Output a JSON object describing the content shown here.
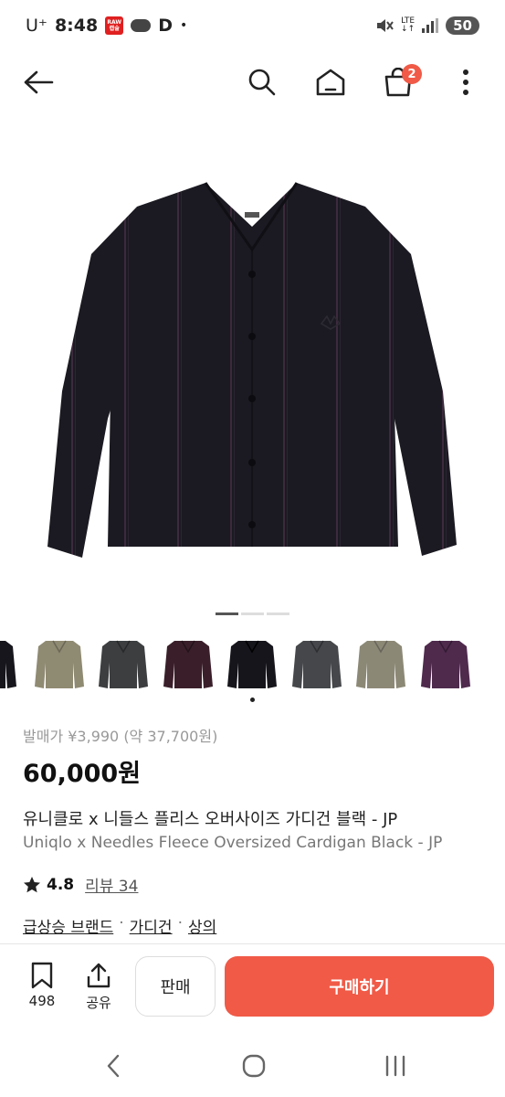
{
  "status_bar": {
    "carrier": "U⁺",
    "time": "8:48",
    "app_badge": "RAW 캡슐",
    "d_label": "D",
    "dot": "•",
    "lte": "LTE",
    "battery": "50"
  },
  "header": {
    "cart_count": "2"
  },
  "carousel": {
    "total": 3,
    "active": 1
  },
  "thumbnails": [
    {
      "name": "thumb-black-partial",
      "color": "#16161c"
    },
    {
      "name": "thumb-olive",
      "color": "#8f8a72"
    },
    {
      "name": "thumb-charcoal",
      "color": "#3c3e40"
    },
    {
      "name": "thumb-burgundy",
      "color": "#3a1f2a"
    },
    {
      "name": "thumb-black",
      "color": "#15151b"
    },
    {
      "name": "thumb-dark-grey",
      "color": "#45474a"
    },
    {
      "name": "thumb-khaki",
      "color": "#8c8876"
    },
    {
      "name": "thumb-purple",
      "color": "#4f2a4d"
    }
  ],
  "product": {
    "original_price": "발매가 ¥3,990 (약 37,700원)",
    "price": "60,000원",
    "title_ko": "유니클로 x 니들스 플리스 오버사이즈 가디건 블랙 - JP",
    "title_en": "Uniqlo x Needles Fleece Oversized Cardigan Black - JP",
    "rating": "4.8",
    "reviews": "리뷰 34",
    "categories": [
      "급상승 브랜드",
      "가디건",
      "상의"
    ],
    "category_sep": "·"
  },
  "actions": {
    "save_count": "498",
    "share_label": "공유",
    "sell_label": "판매",
    "buy_label": "구매하기"
  },
  "colors": {
    "accent": "#f05a47",
    "garment": "#1b1a22",
    "stripe": "#4a2f45"
  }
}
